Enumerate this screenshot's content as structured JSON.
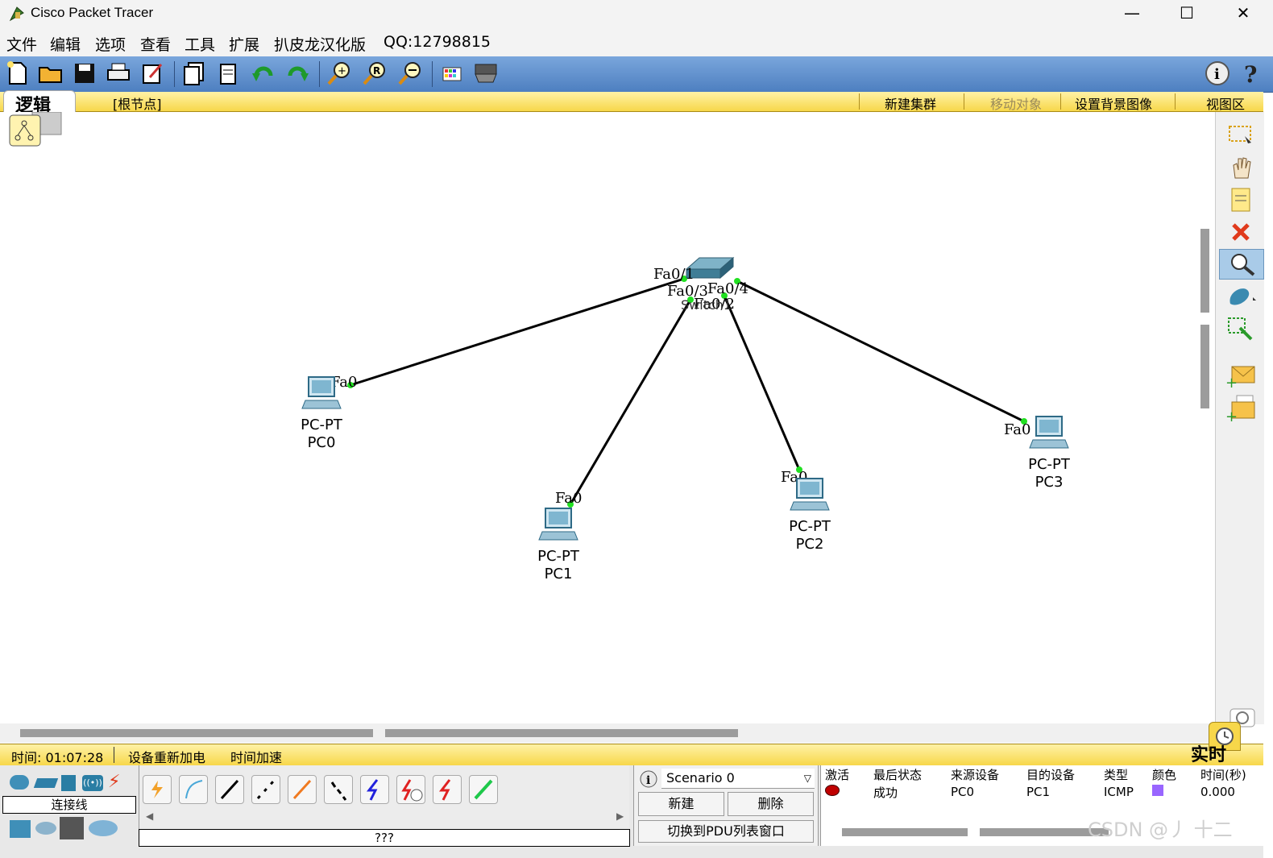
{
  "window": {
    "title": "Cisco Packet Tracer",
    "minimize": "—",
    "maximize": "☐",
    "close": "✕"
  },
  "menu": [
    "文件",
    "编辑",
    "选项",
    "查看",
    "工具",
    "扩展",
    "扒皮龙汉化版",
    "QQ:12798815"
  ],
  "workspace": {
    "tab": "逻辑",
    "root": "[根节点]",
    "new_cluster": "新建集群",
    "move_object": "移动对象",
    "set_background": "设置背景图像",
    "viewport": "视图区"
  },
  "topology": {
    "devices": [
      {
        "type": "PC-PT",
        "name": "PC0"
      },
      {
        "type": "PC-PT",
        "name": "PC1"
      },
      {
        "type": "PC-PT",
        "name": "PC2"
      },
      {
        "type": "PC-PT",
        "name": "PC3"
      }
    ],
    "switch_ports": [
      "Fa0/1",
      "Fa0/3",
      "Fa0/4",
      "Fa0/2"
    ],
    "switch_label": "Switch1",
    "pc_port": "Fa0"
  },
  "status": {
    "time": "时间: 01:07:28",
    "power_cycle": "设备重新加电",
    "fast_forward": "时间加速",
    "realtime": "实时"
  },
  "devices_panel": {
    "category_label": "连接线",
    "selected": "???"
  },
  "scenario": {
    "name": "Scenario 0",
    "new": "新建",
    "delete": "删除",
    "toggle_pdu": "切换到PDU列表窗口"
  },
  "pdu_table": {
    "headers": [
      "激活",
      "最后状态",
      "来源设备",
      "目的设备",
      "类型",
      "颜色",
      "时间(秒)"
    ],
    "rows": [
      {
        "status": "成功",
        "source": "PC0",
        "dest": "PC1",
        "type": "ICMP",
        "color": "#9966ff",
        "time": "0.000"
      }
    ]
  },
  "watermark": "CSDN @丿 十二"
}
